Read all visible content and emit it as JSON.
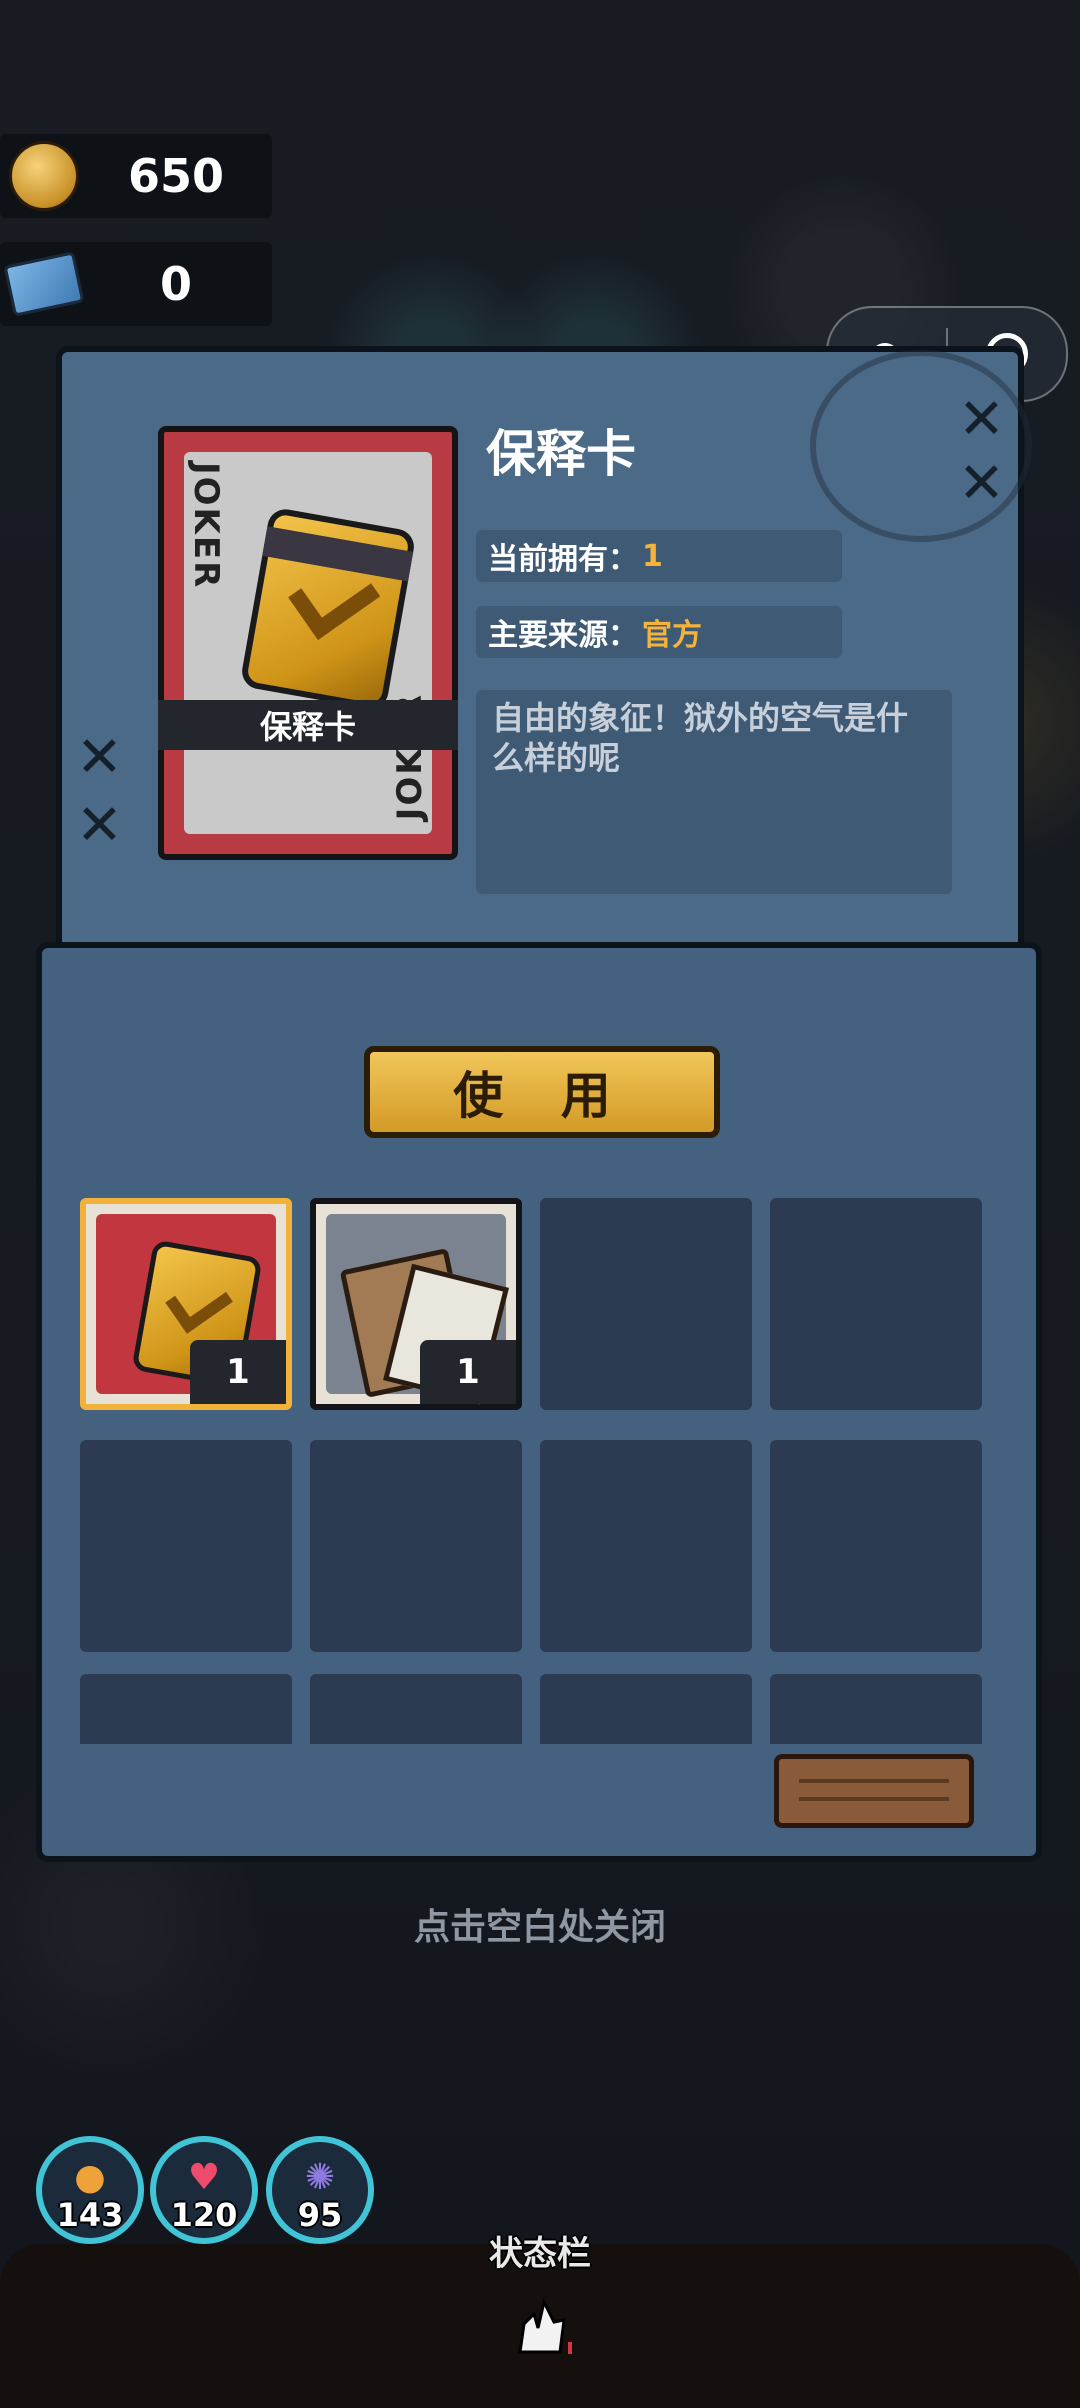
{
  "currency": {
    "coins": "650",
    "tickets": "0"
  },
  "capsule": {
    "more_icon": "more-dots-icon",
    "close_icon": "target-close-icon"
  },
  "item_detail": {
    "name": "保释卡",
    "card_label": "保释卡",
    "joker_text": "JOKER",
    "owned_label": "当前拥有：",
    "owned_value": "1",
    "source_label": "主要来源：",
    "source_value": "官方",
    "description": "自由的象征！狱外的空气是什么样的呢"
  },
  "use_button": "使 用",
  "inventory": [
    {
      "item": "bail-card",
      "count": "1",
      "selected": true
    },
    {
      "item": "document-envelope",
      "count": "1",
      "selected": false
    }
  ],
  "close_hint": "点击空白处关闭",
  "stats": [
    {
      "icon": "hunger-icon",
      "value": "143"
    },
    {
      "icon": "heart-icon",
      "value": "120"
    },
    {
      "icon": "brain-icon",
      "value": "95"
    }
  ],
  "status_bar_title": "状态栏",
  "colors": {
    "panel": "#4b6a88",
    "accent": "#f4b33a",
    "stat_ring": "#41c4d6"
  }
}
